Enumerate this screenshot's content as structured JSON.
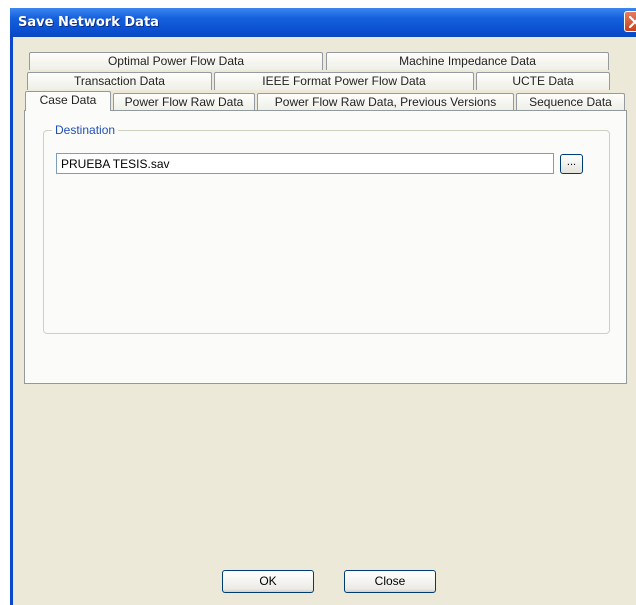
{
  "window": {
    "title": "Save Network Data"
  },
  "tabs": {
    "row1": [
      "Optimal Power Flow Data",
      "Machine Impedance Data"
    ],
    "row2": [
      "Transaction Data",
      "IEEE Format Power Flow Data",
      "UCTE Data"
    ],
    "row3": [
      "Case Data",
      "Power Flow Raw Data",
      "Power Flow Raw Data, Previous Versions",
      "Sequence Data"
    ],
    "active": "Case Data"
  },
  "destination": {
    "group_label": "Destination",
    "path_value": "PRUEBA TESIS.sav",
    "browse_label": "..."
  },
  "buttons": {
    "ok": "OK",
    "close": "Close"
  },
  "colors": {
    "titlebar": "#0a4fcf",
    "dialog_bg": "#ece9d8",
    "group_label": "#1f4fb6",
    "close_button": "#c6421d"
  },
  "icons": {
    "close": "close-x-icon"
  }
}
